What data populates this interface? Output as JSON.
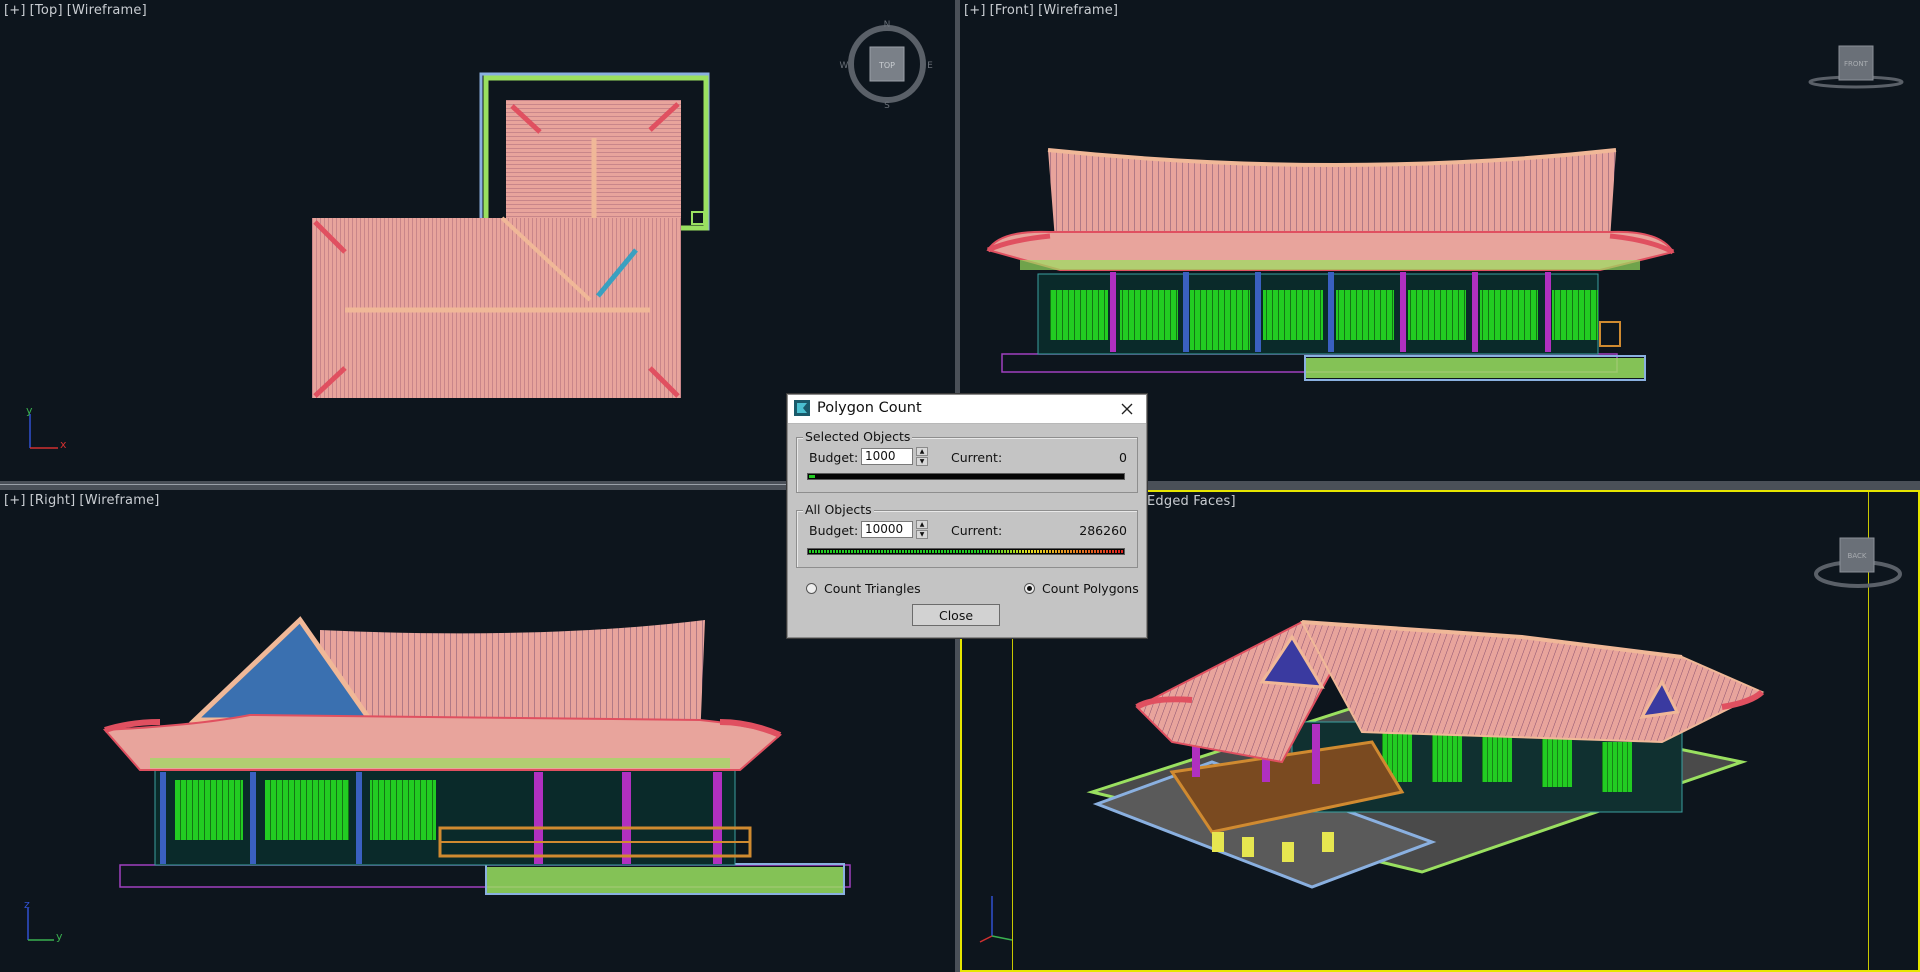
{
  "viewports": {
    "top": {
      "plus": "[+]",
      "view": "[Top]",
      "shading": "[Wireframe]",
      "cube_label": "TOP"
    },
    "front": {
      "plus": "[+]",
      "view": "[Front]",
      "shading": "[Wireframe]",
      "cube_label": "FRONT"
    },
    "right": {
      "plus": "[+]",
      "view": "[Right]",
      "shading": "[Wireframe]"
    },
    "perspective": {
      "shading_partial": "Edged Faces]",
      "cube_label": "BACK"
    }
  },
  "compass": {
    "n": "N",
    "s": "S",
    "e": "E",
    "w": "W"
  },
  "axes": {
    "x": "x",
    "y": "y",
    "z": "z"
  },
  "dialog": {
    "title": "Polygon Count",
    "selected": {
      "group_label": "Selected Objects",
      "budget_label": "Budget:",
      "budget_value": "1000",
      "current_label": "Current:",
      "current_value": "0",
      "fill_fraction": 0.02
    },
    "all": {
      "group_label": "All Objects",
      "budget_label": "Budget:",
      "budget_value": "10000",
      "current_label": "Current:",
      "current_value": "286260",
      "fill_fraction": 1.0
    },
    "count_triangles_label": "Count Triangles",
    "count_polygons_label": "Count Polygons",
    "count_mode": "polygons",
    "close_label": "Close"
  },
  "colors": {
    "roof": "#e8a49c",
    "ridge": "#f0b898",
    "eave_red": "#e05060",
    "wall_green": "#2a9a1a",
    "window_green": "#22cc22",
    "pillar_purple": "#b030c0",
    "base_green": "#9ae060",
    "base_blue": "#8ab0e0",
    "deck_orange": "#d08a30",
    "teal": "#3aa0a0",
    "active_border": "#e6e600",
    "viewport_bg": "#0d151d"
  }
}
